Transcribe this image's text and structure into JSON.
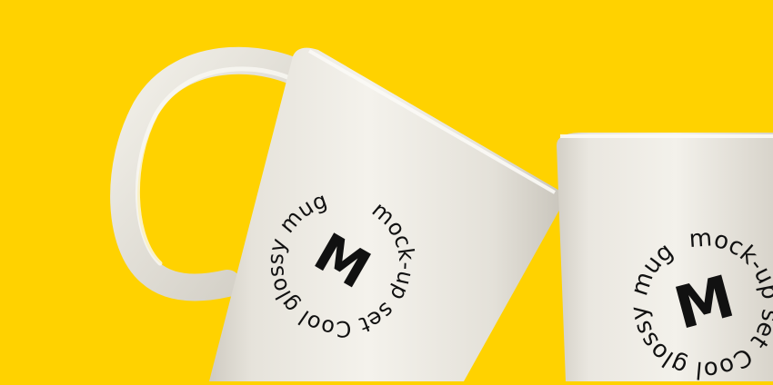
{
  "scene": {
    "background_color": "#FFD200",
    "mug_color": "#EDEAE2",
    "print_color": "#111111"
  },
  "mug_left": {
    "circular_text": "mock-up set  Cool glossy mug ",
    "logo_letter": "M"
  },
  "mug_right": {
    "circular_text": "mock-up set  Cool glossy mug ",
    "logo_letter": "M"
  }
}
